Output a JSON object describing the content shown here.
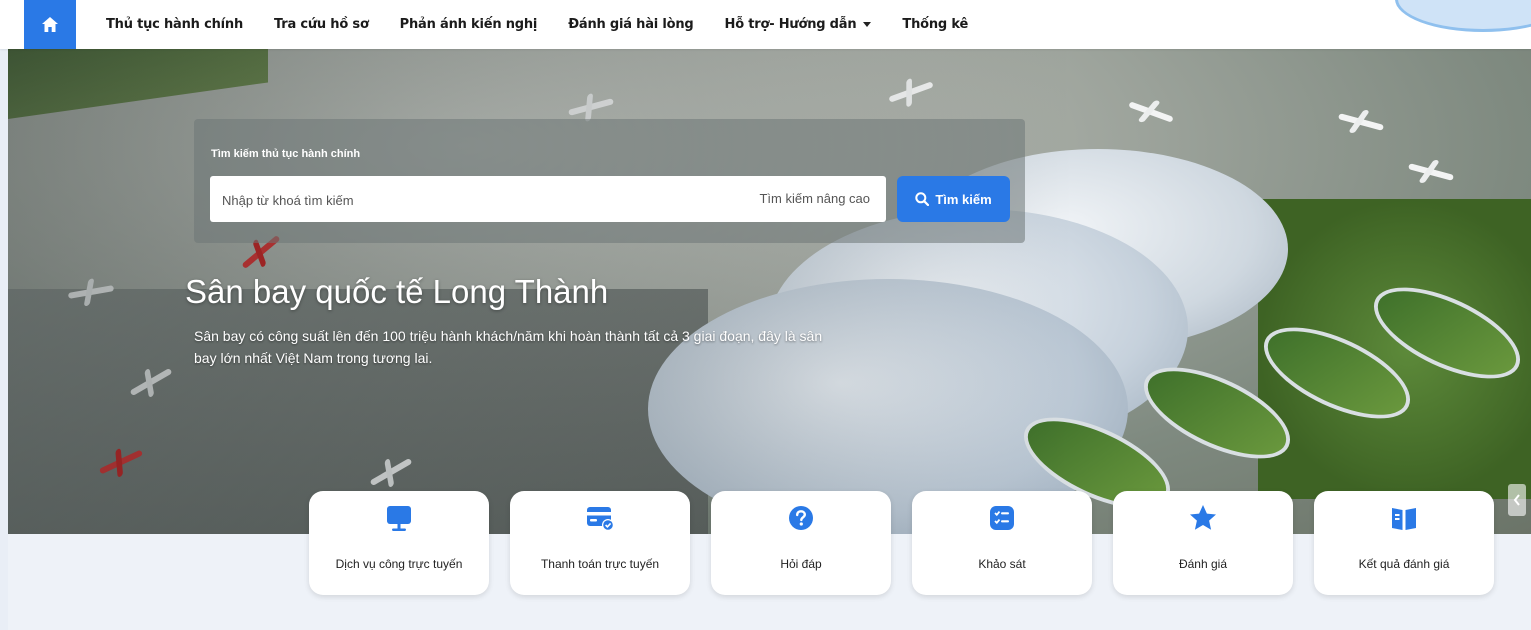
{
  "nav": {
    "home_icon": "home-icon",
    "items": [
      {
        "label": "Thủ tục hành chính"
      },
      {
        "label": "Tra cứu hồ sơ"
      },
      {
        "label": "Phản ánh kiến nghị"
      },
      {
        "label": "Đánh giá hài lòng"
      },
      {
        "label": "Hỗ trợ- Hướng dẫn",
        "has_dropdown": true
      },
      {
        "label": "Thống kê"
      }
    ]
  },
  "search": {
    "title": "Tìm kiếm thủ tục hành chính",
    "placeholder": "Nhập từ khoá tìm kiếm",
    "value": "",
    "advanced_label": "Tìm kiếm nâng cao",
    "button_label": "Tìm kiếm"
  },
  "hero": {
    "title": "Sân bay quốc tế Long Thành",
    "description": "Sân bay có công suất lên đến 100 triệu hành khách/năm khi hoàn thành tất cả 3 giai đoạn, đây là sân bay lớn nhất Việt Nam trong tương lai."
  },
  "services": [
    {
      "label": "Dịch vụ công trực tuyến",
      "icon": "monitor-icon"
    },
    {
      "label": "Thanh toán trực tuyến",
      "icon": "payment-card-icon"
    },
    {
      "label": "Hỏi đáp",
      "icon": "question-icon"
    },
    {
      "label": "Khảo sát",
      "icon": "checklist-icon"
    },
    {
      "label": "Đánh giá",
      "icon": "star-icon"
    },
    {
      "label": "Kết quả đánh giá",
      "icon": "book-icon"
    }
  ],
  "colors": {
    "primary": "#2a79e6",
    "nav_bg": "#ffffff",
    "card_bg": "#ffffff"
  }
}
